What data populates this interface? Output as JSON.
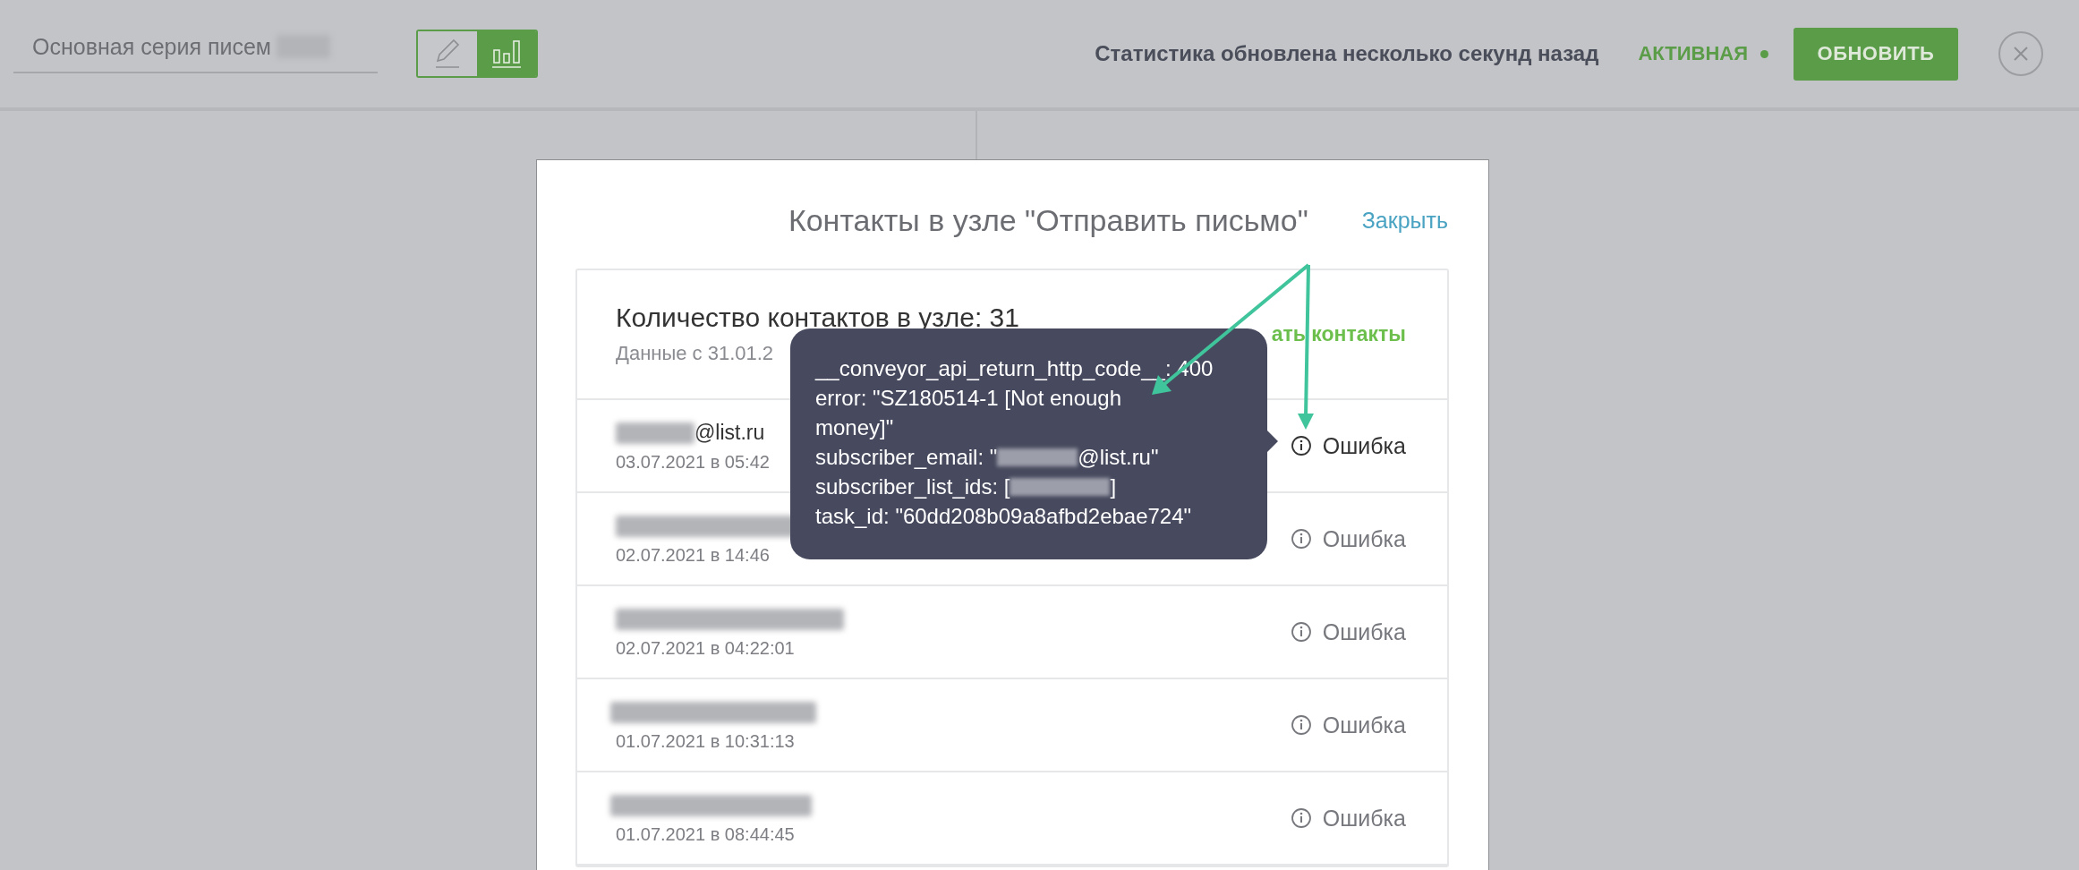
{
  "top_bar": {
    "series_name": {
      "value": "Основная серия писем"
    },
    "view_toggle": [
      {
        "kind": "edit",
        "selected": false
      },
      {
        "kind": "stats",
        "selected": true
      }
    ],
    "stats_status": "Статистика обновлена несколько секунд назад",
    "state": {
      "label": "АКТИВНАЯ",
      "active": true
    },
    "refresh_button": "ОБНОВИТЬ"
  },
  "modal": {
    "title": "Контакты в узле \"Отправить письмо\"",
    "close_link": "Закрыть",
    "summary": {
      "count_text": "Количество контактов в узле: 31",
      "since_text": "Данные с 31.01.2",
      "download_link": "ать контакты"
    },
    "rows": [
      {
        "email": "@list.ru",
        "date": "03.07.2021 в 05:42",
        "status": "Ошибка",
        "hovered": true
      },
      {
        "date": "02.07.2021 в 14:46",
        "status": "Ошибка",
        "hovered": false
      },
      {
        "date": "02.07.2021 в 04:22:01",
        "status": "Ошибка",
        "hovered": false
      },
      {
        "date": "01.07.2021 в 10:31:13",
        "status": "Ошибка",
        "hovered": false
      },
      {
        "date": "01.07.2021 в 08:44:45",
        "status": "Ошибка",
        "hovered": false
      }
    ]
  },
  "tooltip": {
    "lines": [
      {
        "text": "__conveyor_api_return_http_code__: 400"
      },
      {
        "text": "error: \"SZ180514-1 [Not enough"
      },
      {
        "text": "money]\""
      },
      {
        "before": "subscriber_email: \"",
        "after": "@list.ru\""
      },
      {
        "before": "subscriber_list_ids: [",
        "after": "]"
      },
      {
        "text": "task_id: \"60dd208b09a8afbd2ebae724\""
      }
    ]
  }
}
